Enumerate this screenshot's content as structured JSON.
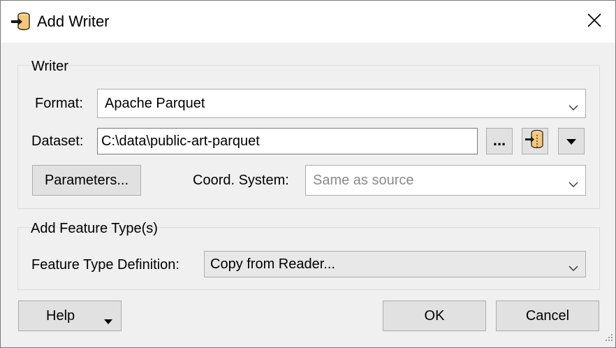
{
  "window": {
    "title": "Add Writer",
    "icons": {
      "app": "writer-database-icon",
      "close": "close-icon"
    }
  },
  "writer_group": {
    "title": "Writer",
    "format_label": "Format:",
    "format_value": "Apache Parquet",
    "dataset_label": "Dataset:",
    "dataset_value": "C:\\data\\public-art-parquet",
    "browse_label": "...",
    "parameters_label": "Parameters...",
    "coord_label": "Coord. System:",
    "coord_placeholder": "Same as source",
    "icons": {
      "dataset_tool": "database-zip-icon",
      "dataset_menu": "triangle-down-icon",
      "combo_chevron": "chevron-down-icon"
    }
  },
  "feature_group": {
    "title": "Add Feature Type(s)",
    "definition_label": "Feature Type Definition:",
    "definition_value": "Copy from Reader..."
  },
  "footer": {
    "help_label": "Help",
    "ok_label": "OK",
    "cancel_label": "Cancel",
    "icons": {
      "help_menu": "triangle-down-icon",
      "resize": "resize-grip-icon"
    }
  }
}
